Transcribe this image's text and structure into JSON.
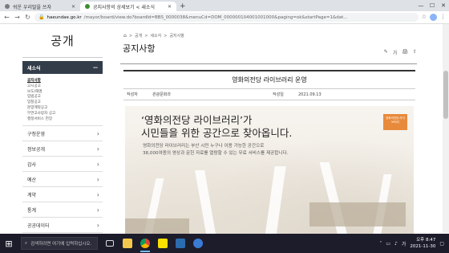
{
  "browser": {
    "tabs": [
      {
        "title": "쉬운 우리말을 쓰자",
        "active": false
      },
      {
        "title": "공지사항의 상세보기 < 새소식",
        "active": true
      }
    ],
    "new_tab_label": "+",
    "url_host": "haeundae.go.kr",
    "url_path": "/mayor/board/view.do?boardId=BBS_0000038&menuCd=DOM_000000104001001000&paging=ok&startPage=1&dat..."
  },
  "sidebar": {
    "title": "공개",
    "active_section": "새소식",
    "active_chev": "—",
    "subitems": [
      {
        "label": "공지사항",
        "on": true
      },
      {
        "label": "고시공고",
        "on": false
      },
      {
        "label": "보도/해명",
        "on": false
      },
      {
        "label": "입법공고",
        "on": false
      },
      {
        "label": "입찰공고",
        "on": false
      },
      {
        "label": "분양계약공고",
        "on": false
      },
      {
        "label": "무연고사망자 공고",
        "on": false
      },
      {
        "label": "행정서비스 헌장",
        "on": false
      }
    ],
    "items": [
      {
        "label": "구청운영"
      },
      {
        "label": "정보공개"
      },
      {
        "label": "감사"
      },
      {
        "label": "예산"
      },
      {
        "label": "계약"
      },
      {
        "label": "통계"
      },
      {
        "label": "공공데이터"
      }
    ]
  },
  "main": {
    "breadcrumb": [
      "공개",
      "새소식",
      "공지사항"
    ],
    "page_title": "공지사항",
    "tools": {
      "print": "🖨",
      "font": "가",
      "share": "⇧"
    },
    "post": {
      "title": "영화의전당 라이브러리 운영",
      "author_label": "작성자",
      "author": "관광문화과",
      "date_label": "작성일",
      "date": "2021.09.13"
    },
    "banner": {
      "headline_1": "‘영화의전당 라이브러리’가",
      "headline_2": "시민들을 위한 공간으로 찾아옵니다.",
      "desc_1": "영화의전당 라이브러리는 부산 시민 누구나 이용 가능한 공간으로",
      "desc_2": "38,000여종의 영상과 문헌 자료를 열람할 수 있는 무료 서비스를 제공합니다.",
      "badge": "영화의전당 라이브러리"
    }
  },
  "taskbar": {
    "search_placeholder": "검색하려면 여기에 입력하십시오.",
    "time_1": "오후 8:47",
    "time_2": "2021-11-30"
  },
  "colors": {
    "sidebar_active_bg": "#333d4a",
    "taskbar_bg": "#1c1c2b",
    "badge": "#e88a3c"
  }
}
